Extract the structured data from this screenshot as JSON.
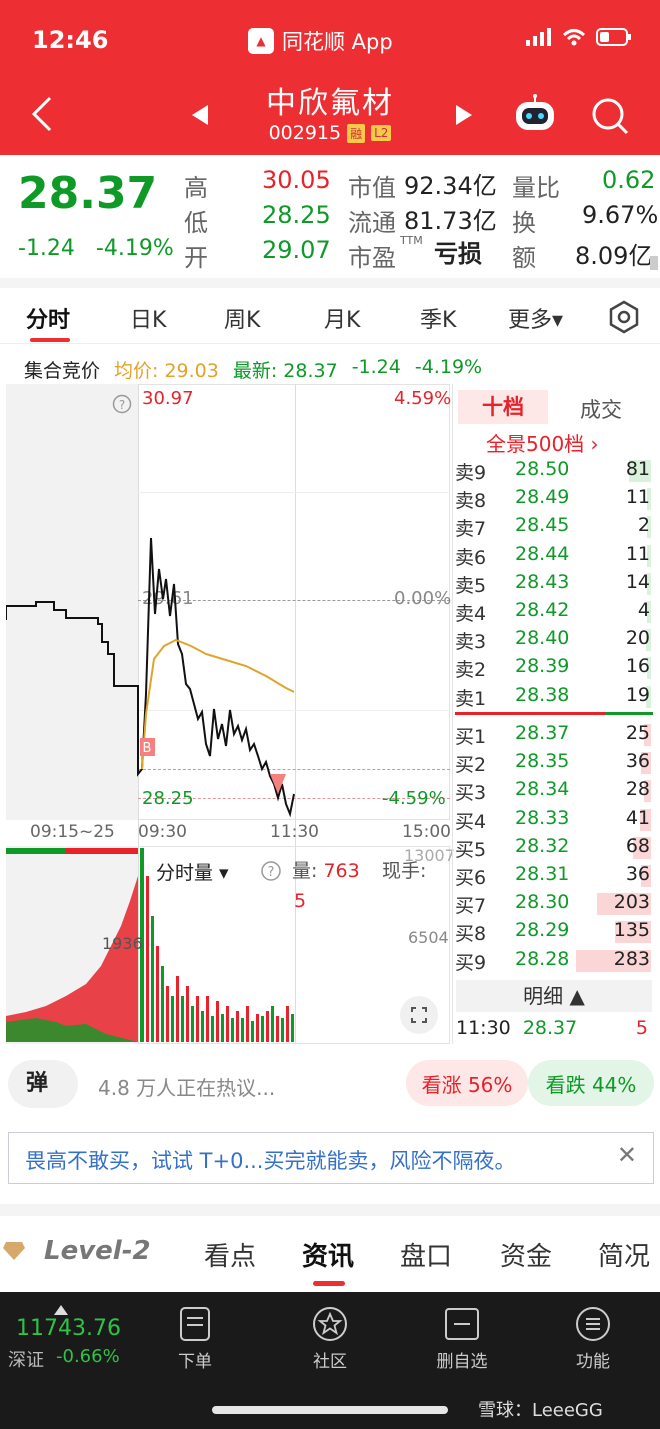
{
  "status_bar": {
    "time": "12:46",
    "app_name": "同花顺 App"
  },
  "header": {
    "title": "中欣氟材",
    "code": "002915",
    "tag1": "融",
    "tag2": "L2"
  },
  "quote": {
    "price": "28.37",
    "change": "-1.24",
    "change_pct": "-4.19%",
    "high_label": "高",
    "high": "30.05",
    "low_label": "低",
    "low": "28.25",
    "open_label": "开",
    "open": "29.07",
    "mktcap_label": "市值",
    "mktcap": "92.34亿",
    "float_label": "流通",
    "float": "81.73亿",
    "pe_label": "市盈",
    "pe_sup": "TTM",
    "pe": "亏损",
    "vol_ratio_label": "量比",
    "vol_ratio": "0.62",
    "turnover_label": "换",
    "turnover": "9.67%",
    "amount_label": "额",
    "amount": "8.09亿"
  },
  "tabs": [
    "分时",
    "日K",
    "周K",
    "月K",
    "季K",
    "更多▾"
  ],
  "legend": {
    "auction": "集合竞价",
    "avg": "均价: 29.03",
    "latest": "最新: 28.37",
    "chg": "-1.24",
    "pct": "-4.19%"
  },
  "chart": {
    "top_price": "30.97",
    "top_pct": "4.59%",
    "mid_price": "29.61",
    "mid_pct": "0.00%",
    "bottom_price": "28.25",
    "bottom_pct": "-4.59%",
    "times": [
      "09:15~25",
      "09:30",
      "11:30",
      "15:00"
    ],
    "vol_label": "分时量 ▾",
    "vol_text": "量:",
    "vol_value": "763",
    "vol_extra": "5",
    "now_hand": "现手:",
    "vol_top": "13007",
    "vol_mid": "6504",
    "auction_vol": "1936",
    "b_marker": "B"
  },
  "book": {
    "tab1": "十档",
    "tab2": "成交",
    "panorama": "全景500档 ›",
    "asks": [
      {
        "label": "卖9",
        "price": "28.50",
        "vol": "81"
      },
      {
        "label": "卖8",
        "price": "28.49",
        "vol": "11"
      },
      {
        "label": "卖7",
        "price": "28.45",
        "vol": "2"
      },
      {
        "label": "卖6",
        "price": "28.44",
        "vol": "11"
      },
      {
        "label": "卖5",
        "price": "28.43",
        "vol": "14"
      },
      {
        "label": "卖4",
        "price": "28.42",
        "vol": "4"
      },
      {
        "label": "卖3",
        "price": "28.40",
        "vol": "20"
      },
      {
        "label": "卖2",
        "price": "28.39",
        "vol": "16"
      },
      {
        "label": "卖1",
        "price": "28.38",
        "vol": "19"
      }
    ],
    "bids": [
      {
        "label": "买1",
        "price": "28.37",
        "vol": "25"
      },
      {
        "label": "买2",
        "price": "28.35",
        "vol": "36"
      },
      {
        "label": "买3",
        "price": "28.34",
        "vol": "28"
      },
      {
        "label": "买4",
        "price": "28.33",
        "vol": "41"
      },
      {
        "label": "买5",
        "price": "28.32",
        "vol": "68"
      },
      {
        "label": "买6",
        "price": "28.31",
        "vol": "36"
      },
      {
        "label": "买7",
        "price": "28.30",
        "vol": "203"
      },
      {
        "label": "买8",
        "price": "28.29",
        "vol": "135"
      },
      {
        "label": "买9",
        "price": "28.28",
        "vol": "283"
      }
    ],
    "detail_label": "明细 ▲",
    "last_trade": {
      "time": "11:30",
      "price": "28.37",
      "vol": "5"
    }
  },
  "social": {
    "danmu": "弹",
    "discussing": "4.8 万人正在热议...",
    "bull": "看涨 56%",
    "bear": "看跌 44%"
  },
  "banner": {
    "text": "畏高不敢买，试试 T+0...买完就能卖，风险不隔夜。"
  },
  "subtabs": [
    "Level-2",
    "看点",
    "资讯",
    "盘口",
    "资金",
    "简况"
  ],
  "bottom": {
    "index_value": "11743.76",
    "index_name": "深证",
    "index_pct": "-0.66%",
    "nav": [
      "下单",
      "社区",
      "删自选",
      "功能"
    ],
    "watermark": "雪球：LeeeGG"
  }
}
